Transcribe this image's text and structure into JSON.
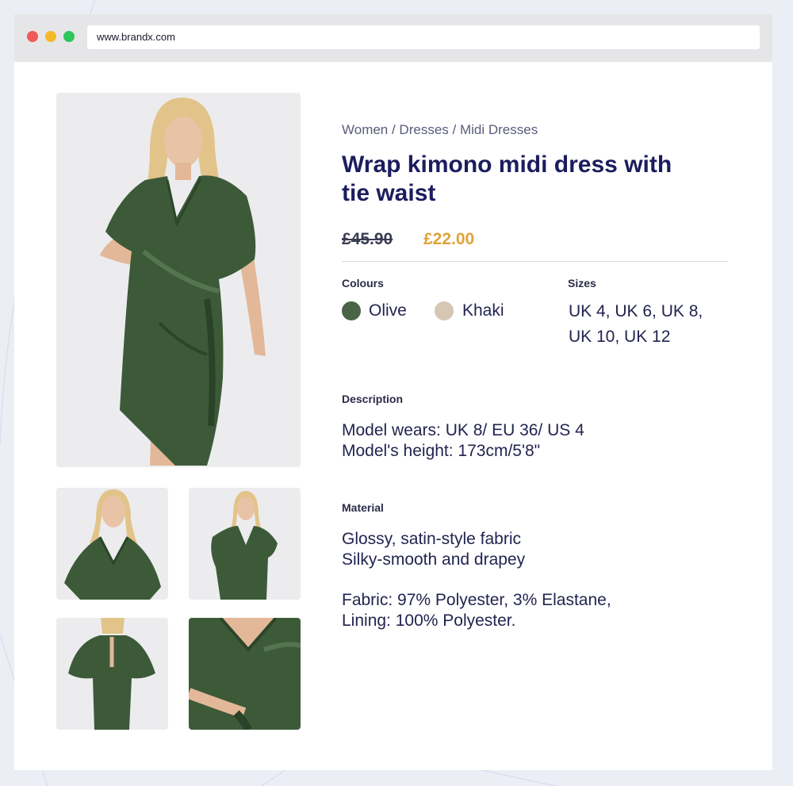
{
  "browser": {
    "url": "www.brandx.com"
  },
  "gallery": {
    "main_alt": "Model wearing olive wrap kimono midi dress",
    "thumbnails": [
      "Front close-up of dress",
      "Side view of dress",
      "Back view of dress",
      "Tie waist detail"
    ]
  },
  "product": {
    "breadcrumb": "Women / Dresses / Midi Dresses",
    "title_line1": "Wrap kimono midi dress with",
    "title_line2": "tie waist",
    "price_old": "£45.90",
    "price_new": "£22.00",
    "colours_label": "Colours",
    "colours": [
      {
        "name": "Olive",
        "swatch": "#4b6347"
      },
      {
        "name": "Khaki",
        "swatch": "#d6c6b4"
      }
    ],
    "sizes_label": "Sizes",
    "sizes_line1": "UK 4, UK 6, UK 8,",
    "sizes_line2": "UK 10, UK 12",
    "description_label": "Description",
    "description_line1": "Model wears: UK 8/ EU 36/ US 4",
    "description_line2": "Model's height: 173cm/5'8\"",
    "material_label": "Material",
    "material_line1": "Glossy, satin-style fabric",
    "material_line2": "Silky-smooth and drapey",
    "material_line3": "Fabric: 97% Polyester, 3% Elastane,",
    "material_line4": "Lining: 100% Polyester."
  },
  "colors": {
    "accent_price": "#e0a43a",
    "title": "#1b1d5e",
    "dress": "#3c5a38"
  }
}
